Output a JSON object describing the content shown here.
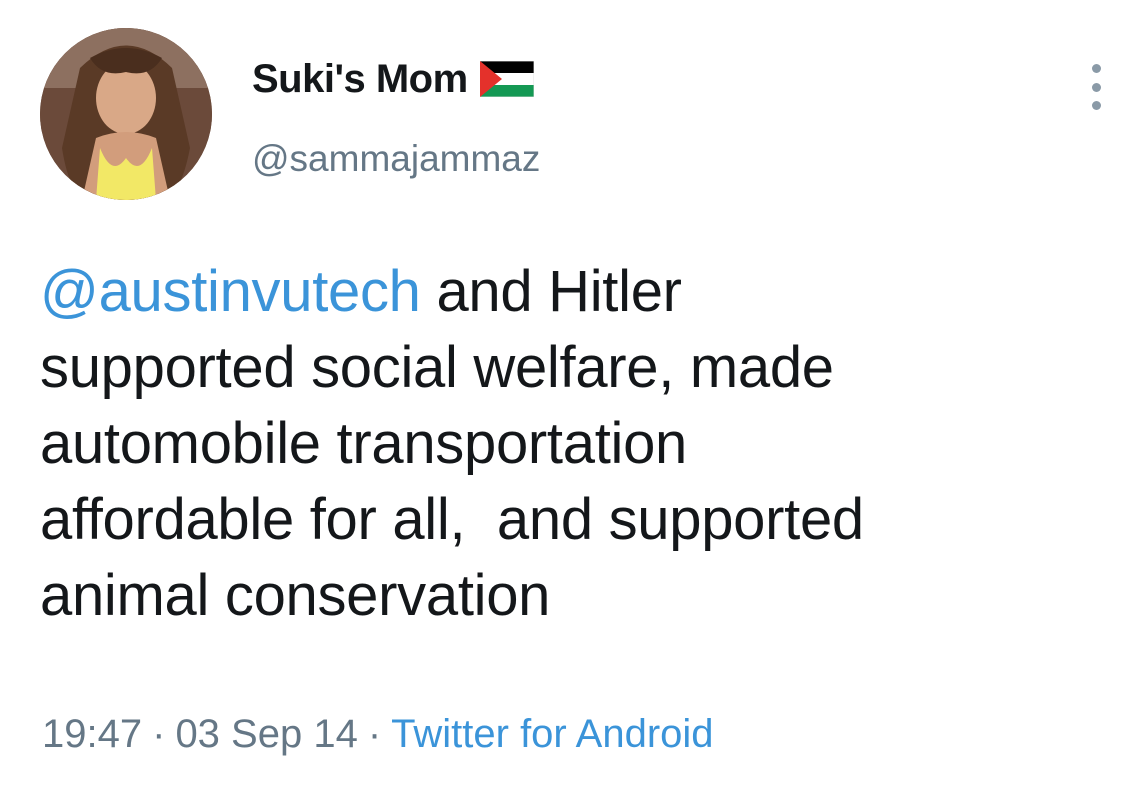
{
  "tweet": {
    "display_name": "Suki's Mom",
    "flag_icon": "palestine-flag-icon",
    "handle": "@sammajammaz",
    "more_icon": "vertical-ellipsis-icon",
    "mention": "@austinvutech",
    "lines": {
      "line1_rest": " and Hitler",
      "line2": "supported social welfare, made",
      "line3": "automobile transportation",
      "line4": "affordable for all,  and supported",
      "line5": "animal conservation"
    },
    "time": "19:47",
    "separator1": "·",
    "date": "03 Sep 14",
    "separator2": "·",
    "source": "Twitter for Android"
  },
  "colors": {
    "link": "#3b94d9",
    "text": "#14171a",
    "secondary": "#657786",
    "flag_green": "#149954",
    "flag_red": "#e4312b",
    "flag_black": "#000000"
  }
}
